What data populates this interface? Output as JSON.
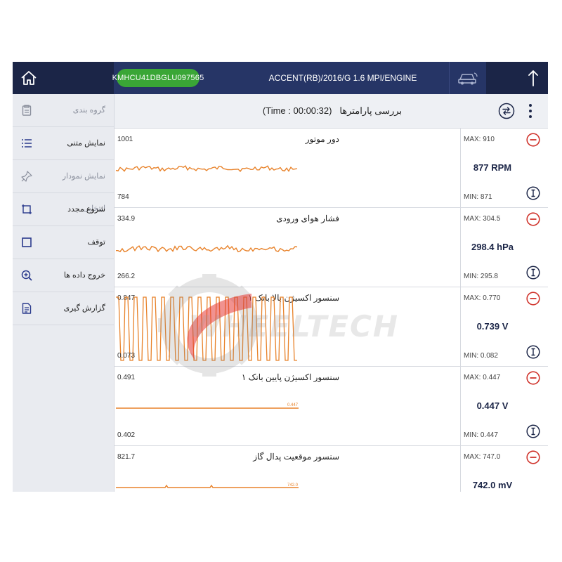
{
  "topbar": {
    "vin": "KMHCU41DBGLU097565",
    "vehicle_title": "ACCENT(RB)/2016/G 1.6 MPI/ENGINE"
  },
  "sidebar": {
    "items": [
      {
        "label": "گروه بندی",
        "icon": "group-icon",
        "enabled": false
      },
      {
        "label": "نمایش متنی",
        "icon": "list-icon",
        "enabled": true
      },
      {
        "label": "نمایش نمودار انتخابی",
        "icon": "chart-pin-icon",
        "enabled": false
      },
      {
        "label": "شروع مجدد",
        "icon": "restart-icon",
        "enabled": true
      },
      {
        "label": "توقف",
        "icon": "stop-icon",
        "enabled": true
      },
      {
        "label": "خروج داده ها",
        "icon": "zoom-export-icon",
        "enabled": true
      },
      {
        "label": "گزارش گیری",
        "icon": "report-icon",
        "enabled": true
      }
    ]
  },
  "header": {
    "title": "بررسی پارامترها",
    "time": "(Time : 00:00:32)"
  },
  "params": [
    {
      "name": "دور موتور",
      "ymax": "1001",
      "ymin": "784",
      "max_label": "MAX: 910",
      "min_label": "MIN: 871",
      "value": "877 RPM",
      "trace_label": ""
    },
    {
      "name": "فشار هوای ورودی",
      "ymax": "334.9",
      "ymin": "266.2",
      "max_label": "MAX: 304.5",
      "min_label": "MIN: 295.8",
      "value": "298.4 hPa",
      "trace_label": ""
    },
    {
      "name": "سنسور اکسیژن بالا بانک ۱",
      "ymax": "0.847",
      "ymin": "0.073",
      "max_label": "MAX: 0.770",
      "min_label": "MIN: 0.082",
      "value": "0.739 V",
      "trace_label": ""
    },
    {
      "name": "سنسور اکسیژن پایین بانک ۱",
      "ymax": "0.491",
      "ymin": "0.402",
      "max_label": "MAX: 0.447",
      "min_label": "MIN: 0.447",
      "value": "0.447 V",
      "trace_label": "0.447"
    },
    {
      "name": "سنسور موقعیت پدال گاز",
      "ymax": "821.7",
      "ymin": "",
      "max_label": "MAX: 747.0",
      "min_label": "",
      "value": "742.0 mV",
      "trace_label": "742.0"
    }
  ],
  "watermark": "WHEELTECH",
  "colors": {
    "topbar": "#1b2547",
    "vin_pill": "#3aa636",
    "trace": "#e8822a",
    "remove": "#d0342c",
    "accent": "#1b2547"
  }
}
